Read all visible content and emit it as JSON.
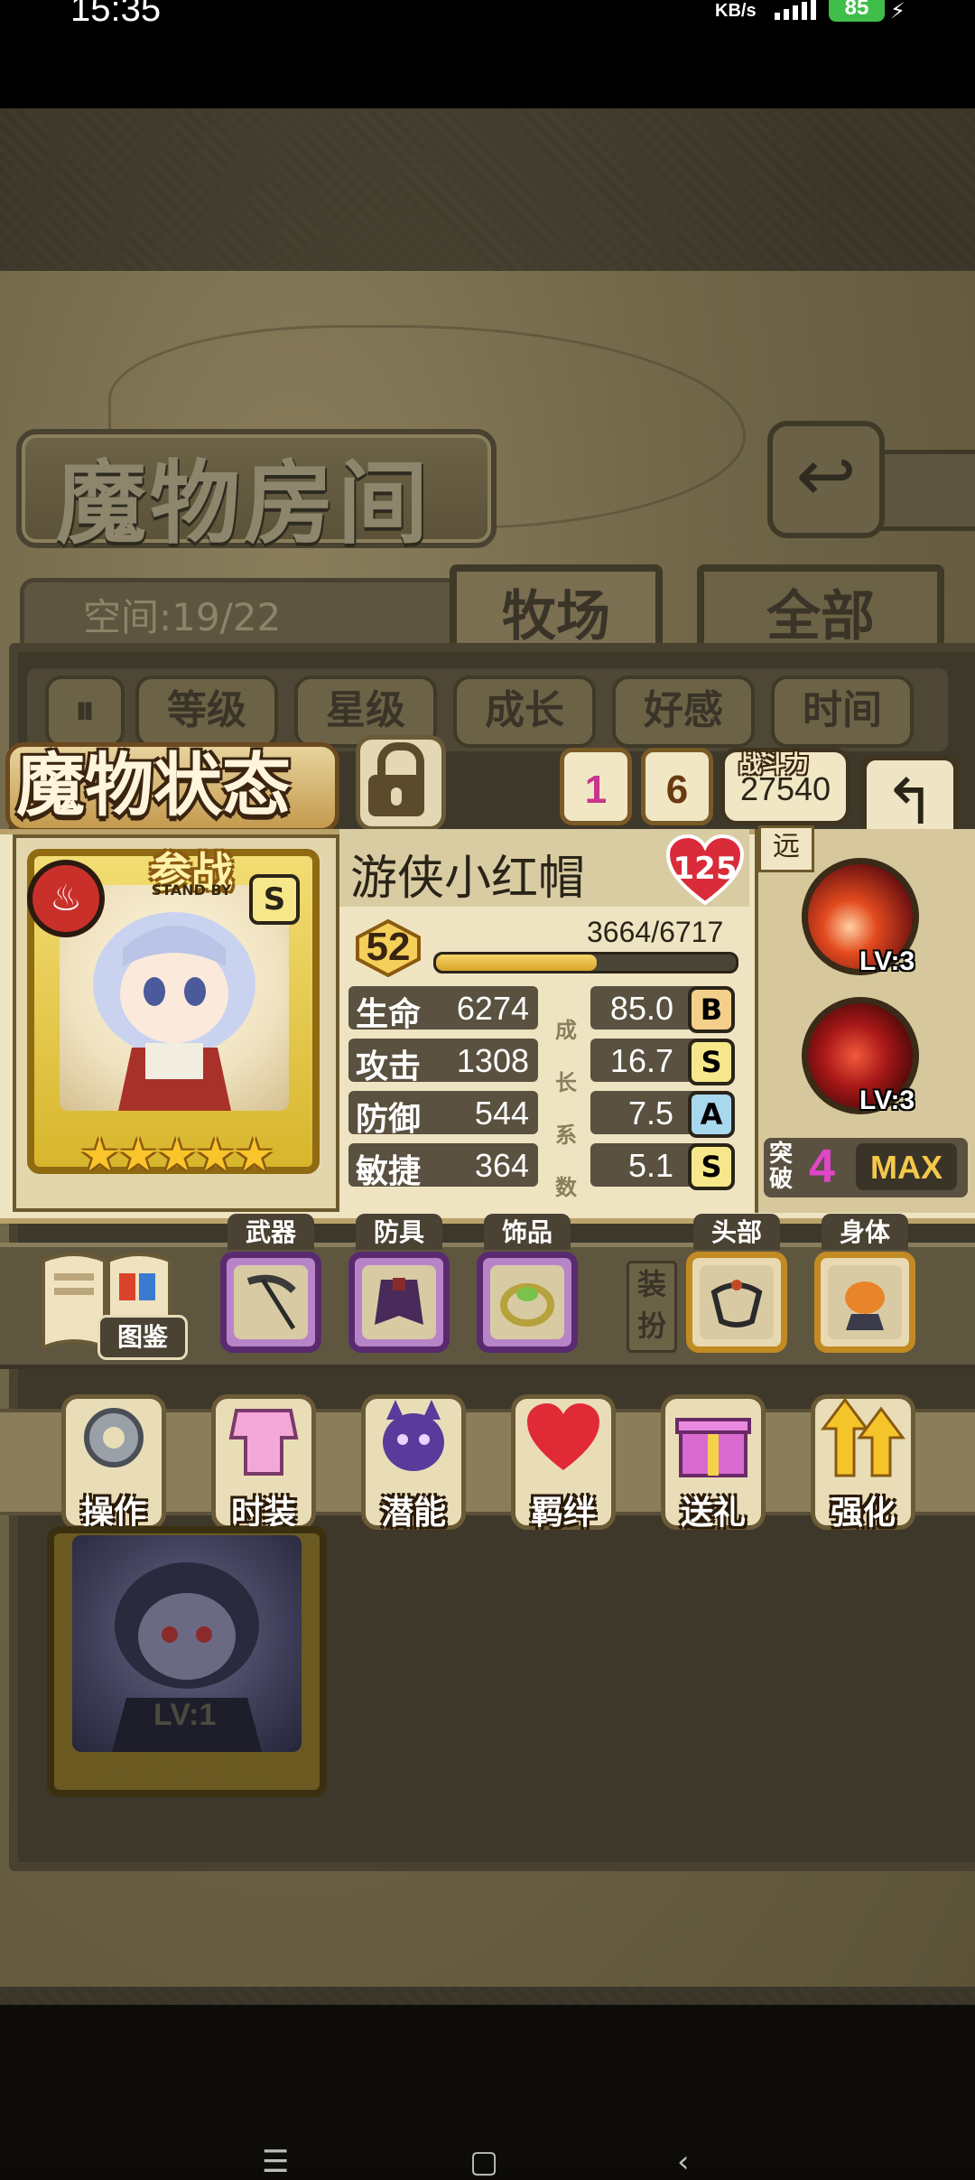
{
  "status_bar": {
    "time": "15:35",
    "net_speed": "KB/s",
    "battery": "85"
  },
  "room": {
    "title": "魔物房间",
    "space": "空间:19/22",
    "tabs": [
      "牧场",
      "全部"
    ]
  },
  "sort_buttons": [
    "等级",
    "星级",
    "成长",
    "好感",
    "时间"
  ],
  "monster_status": {
    "title": "魔物状态",
    "bond_label": "羁绊",
    "bond": "1",
    "potential_label": "潜能",
    "potential": "6",
    "power_label": "战斗力",
    "power": "27540"
  },
  "card": {
    "standby": "参战",
    "standby_en": "STAND BY",
    "rank": "S",
    "stars": "★★★★★",
    "star_count": 5
  },
  "monster": {
    "name": "游侠小红帽",
    "affection": "125",
    "level": "52",
    "exp": "3664/6717",
    "exp_fraction": 0.5455,
    "growth_label": [
      "成",
      "长",
      "系",
      "数"
    ],
    "stats": [
      {
        "name": "生命",
        "value": "6274",
        "growth": "85.0",
        "grade": "B"
      },
      {
        "name": "攻击",
        "value": "1308",
        "growth": "16.7",
        "grade": "S"
      },
      {
        "name": "防御",
        "value": "544",
        "growth": "7.5",
        "grade": "A"
      },
      {
        "name": "敏捷",
        "value": "364",
        "growth": "5.1",
        "grade": "S"
      }
    ],
    "range": "远",
    "skills": [
      {
        "level": "LV:3"
      },
      {
        "level": "LV:3"
      }
    ],
    "breakthrough_label": "突破",
    "breakthrough": "4",
    "max": "MAX"
  },
  "equipment": {
    "book_label": "图鉴",
    "slots": [
      "武器",
      "防具",
      "饰品",
      "头部",
      "身体"
    ],
    "dress_label": "装扮"
  },
  "actions": [
    "操作",
    "时装",
    "潜能",
    "羁绊",
    "送礼",
    "强化"
  ],
  "bottom_card": {
    "level": "LV:1",
    "stars": "★★★★★"
  }
}
